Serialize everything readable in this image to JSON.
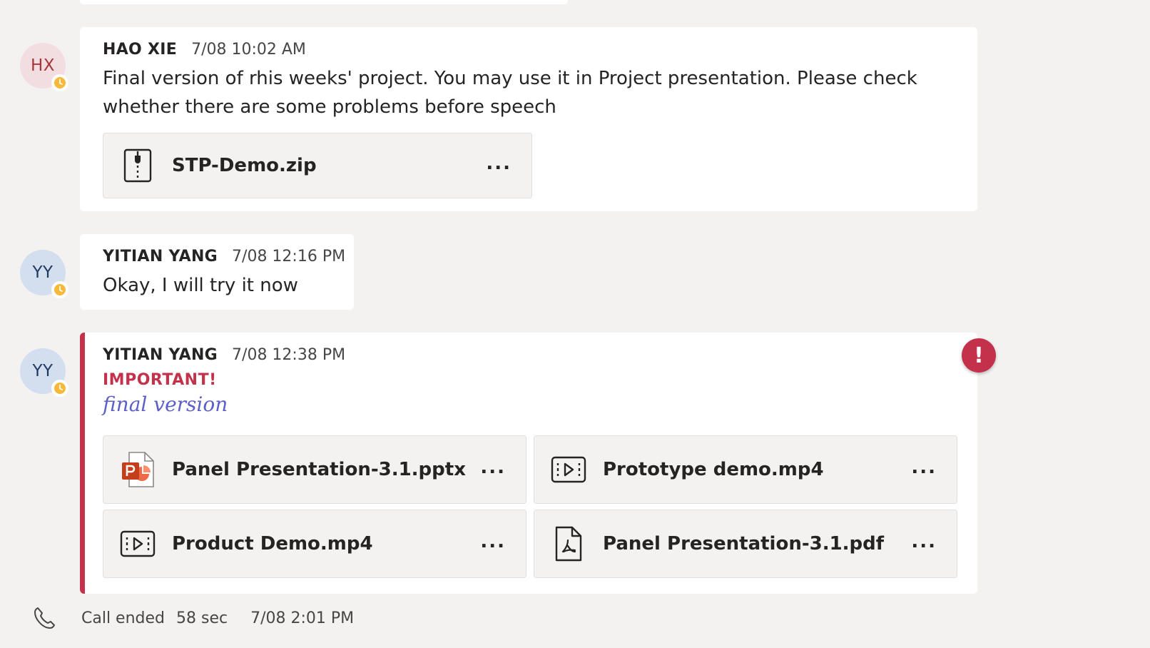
{
  "messages": [
    {
      "initials": "HX",
      "author": "HAO XIE",
      "timestamp": "7/08 10:02 AM",
      "text": "Final version of rhis weeks' project. You may use it in Project presentation. Please check whether there are some problems before speech",
      "attachments": [
        {
          "name": "STP-Demo.zip",
          "icon": "zip-file-icon"
        }
      ]
    },
    {
      "initials": "YY",
      "author": "YITIAN YANG",
      "timestamp": "7/08 12:16 PM",
      "text": "Okay, I will try it now"
    },
    {
      "initials": "YY",
      "author": "YITIAN YANG",
      "timestamp": "7/08 12:38 PM",
      "important_label": "IMPORTANT!",
      "subject": "final version",
      "importance_badge": "!",
      "attachments": [
        {
          "name": "Panel Presentation-3.1.pptx",
          "icon": "powerpoint-file-icon"
        },
        {
          "name": "Prototype demo.mp4",
          "icon": "video-file-icon"
        },
        {
          "name": "Product Demo.mp4",
          "icon": "video-file-icon"
        },
        {
          "name": "Panel Presentation-3.1.pdf",
          "icon": "pdf-file-icon"
        }
      ]
    }
  ],
  "more_options_label": "...",
  "call": {
    "label": "Call ended",
    "duration": "58 sec",
    "time": "7/08 2:01 PM",
    "icon": "phone-icon"
  },
  "colors": {
    "background": "#f3f2f1",
    "important": "#c4314b",
    "subject": "#5b5fc7",
    "presence_away": "#f8b93a"
  }
}
